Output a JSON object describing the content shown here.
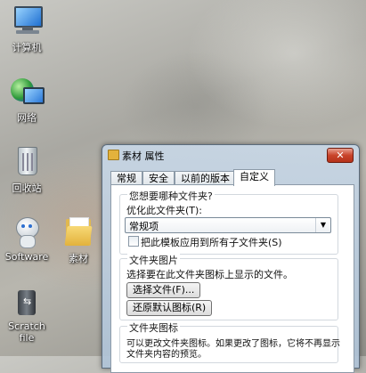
{
  "desktop": {
    "icons": [
      {
        "label": "计算机",
        "icon": "computer-icon"
      },
      {
        "label": "网络",
        "icon": "network-icon"
      },
      {
        "label": "回收站",
        "icon": "recycle-bin-icon"
      },
      {
        "label": "Software",
        "icon": "software-robot-icon"
      },
      {
        "label": "素材",
        "icon": "folder-icon"
      },
      {
        "label": "Scratch file",
        "icon": "usb-drive-icon"
      }
    ]
  },
  "dialog": {
    "title": "素材 属性",
    "close_label": "✕",
    "tabs": [
      "常规",
      "安全",
      "以前的版本",
      "自定义"
    ],
    "active_tab": "自定义",
    "section1": {
      "title": "您想要哪种文件夹?",
      "optimize_label": "优化此文件夹(T):",
      "select_value": "常规项",
      "checkbox_label": "把此模板应用到所有子文件夹(S)",
      "checkbox_checked": false
    },
    "section2": {
      "title": "文件夹图片",
      "description": "选择要在此文件夹图标上显示的文件。",
      "choose_file_button": "选择文件(F)...",
      "restore_default_button": "还原默认图标(R)"
    },
    "section3": {
      "title": "文件夹图标",
      "description_line1": "可以更改文件夹图标。如果更改了图标，它将不再显示",
      "description_line2": "文件夹内容的预览。"
    }
  }
}
